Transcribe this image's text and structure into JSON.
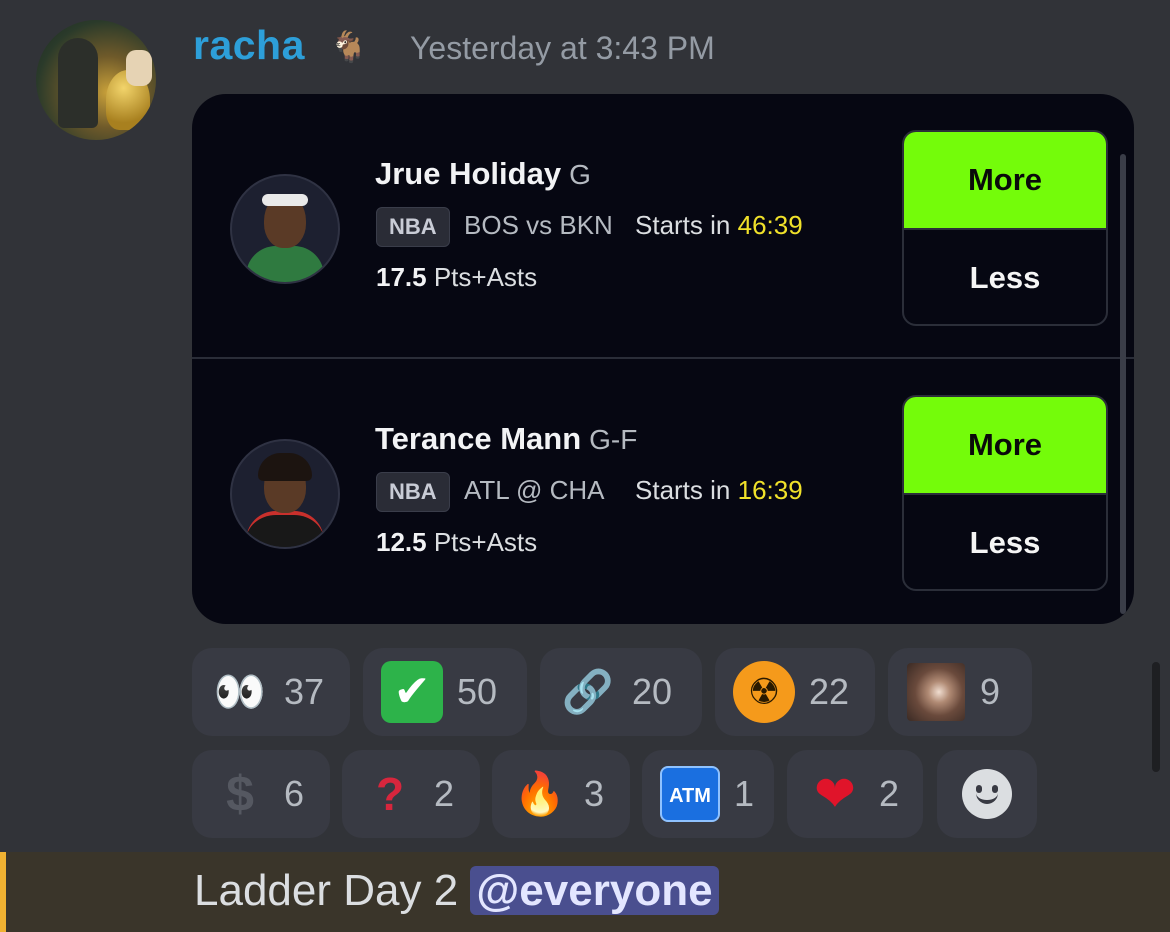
{
  "message": {
    "username": "racha",
    "username_emoji": "🐐",
    "timestamp": "Yesterday at 3:43 PM"
  },
  "picks": [
    {
      "player": "Jrue Holiday",
      "position": "G",
      "league": "NBA",
      "matchup": "BOS vs BKN",
      "starts_label": "Starts in",
      "starts_value": "46:39",
      "line": "17.5",
      "stat": "Pts+Asts",
      "more_label": "More",
      "less_label": "Less"
    },
    {
      "player": "Terance Mann",
      "position": "G-F",
      "league": "NBA",
      "matchup": "ATL @ CHA",
      "starts_label": "Starts in",
      "starts_value": "16:39",
      "line": "12.5",
      "stat": "Pts+Asts",
      "more_label": "More",
      "less_label": "Less"
    }
  ],
  "reactions": [
    {
      "emoji": "👀",
      "icon": "eyes-icon",
      "count": "37"
    },
    {
      "emoji": "✔",
      "icon": "check-mark-icon",
      "count": "50"
    },
    {
      "emoji": "🔗",
      "icon": "link-icon",
      "count": "20"
    },
    {
      "emoji": "☢",
      "icon": "radioactive-icon",
      "count": "22"
    },
    {
      "emoji": "",
      "icon": "custom-image-icon",
      "count": "9"
    },
    {
      "emoji": "$",
      "icon": "dollar-icon",
      "count": "6"
    },
    {
      "emoji": "?",
      "icon": "question-mark-icon",
      "count": "2"
    },
    {
      "emoji": "🔥",
      "icon": "fire-icon",
      "count": "3"
    },
    {
      "emoji": "ATM",
      "icon": "atm-icon",
      "count": "1"
    },
    {
      "emoji": "❤",
      "icon": "heart-icon",
      "count": "2"
    }
  ],
  "next_message": {
    "text": "Ladder Day 2",
    "mention": "@everyone"
  },
  "colors": {
    "more_button": "#74fc0a",
    "countdown": "#f0e12a",
    "username": "#2d9fd9"
  }
}
